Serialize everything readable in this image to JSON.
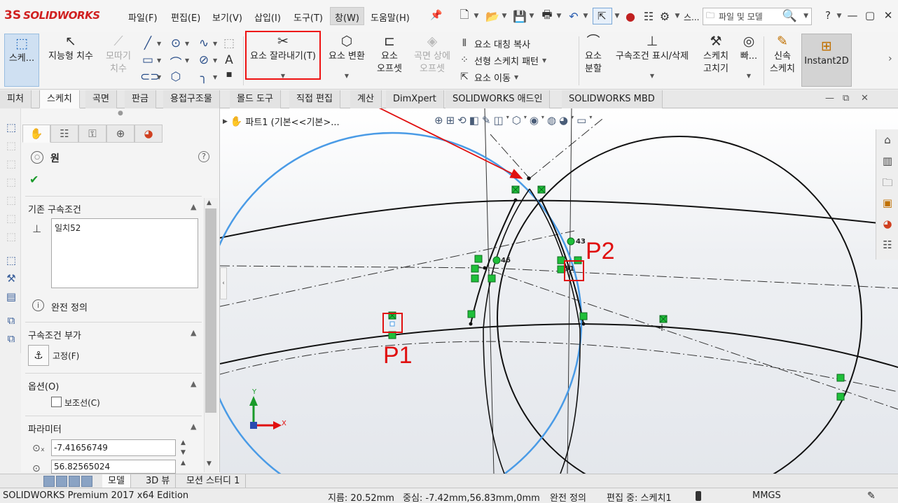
{
  "app": {
    "logo_mark": "3S",
    "logo_text": "SOLIDWORKS"
  },
  "menu": [
    {
      "label": "파일(F)"
    },
    {
      "label": "편집(E)"
    },
    {
      "label": "보기(V)"
    },
    {
      "label": "삽입(I)"
    },
    {
      "label": "도구(T)"
    },
    {
      "label": "창(W)"
    },
    {
      "label": "도움말(H)"
    }
  ],
  "toolbar": {
    "sketch_label": "스케...",
    "smart_dim": "지능형 치수",
    "chamfer_l1": "모따기",
    "chamfer_l2": "치수",
    "trim": "요소 잘라내기(T)",
    "convert": "요소 변환",
    "offset_l1": "요소",
    "offset_l2": "오프셋",
    "surface_offset_l1": "곡면 상에",
    "surface_offset_l2": "오프셋",
    "mirror": "요소 대칭 복사",
    "linear_pattern": "선형 스케치 패턴",
    "move": "요소 이동",
    "split_l1": "요소",
    "split_l2": "분할",
    "relations": "구속조건 표시/삭제",
    "repair_l1": "스케치",
    "repair_l2": "고치기",
    "quick_snaps": "빠...",
    "rapid_l1": "신속",
    "rapid_l2": "스케치",
    "instant2d": "Instant2D",
    "trim_icon": "scissors-icon"
  },
  "search": {
    "placeholder": "파일 및 모델",
    "more": "스..."
  },
  "tabs": [
    {
      "label": "피처"
    },
    {
      "label": "스케치"
    },
    {
      "label": "곡면"
    },
    {
      "label": "판금"
    },
    {
      "label": "용접구조물"
    },
    {
      "label": "몰드 도구"
    },
    {
      "label": "직접 편집"
    },
    {
      "label": "계산"
    },
    {
      "label": "DimXpert"
    },
    {
      "label": "SOLIDWORKS 애드인"
    },
    {
      "label": "SOLIDWORKS MBD"
    }
  ],
  "property_manager": {
    "title": "원",
    "existing_relations": "기존 구속조건",
    "relations": [
      "일치52"
    ],
    "status": "완전 정의",
    "add_relations": "구속조건 부가",
    "fix_label": "고정(F)",
    "options": "옵션(O)",
    "construction": "보조선(C)",
    "parameters": "파라미터",
    "param_x": "-7.41656749",
    "param_y": "56.82565024",
    "help": "?"
  },
  "graphics": {
    "tree_label": "파트1  (기본<<기본>...",
    "p1": "P1",
    "p2": "P2",
    "pt_43": "43",
    "pt_46": "46",
    "pt_51": "51",
    "axis_x": "X",
    "axis_y": "Y"
  },
  "bottom_tabs": [
    {
      "label": "모델"
    },
    {
      "label": "3D 뷰"
    },
    {
      "label": "모션 스터디 1"
    }
  ],
  "statusbar": {
    "edition": "SOLIDWORKS Premium 2017 x64 Edition",
    "diameter": "지름: 20.52mm",
    "center": "중심: -7.42mm,56.83mm,0mm",
    "definition": "완전 정의",
    "editing": "편집 중: 스케치1",
    "units": "MMGS"
  },
  "colors": {
    "accent_red": "#e01010",
    "selected_circle": "#4a9be6",
    "relation_green": "#1fbf3a"
  }
}
